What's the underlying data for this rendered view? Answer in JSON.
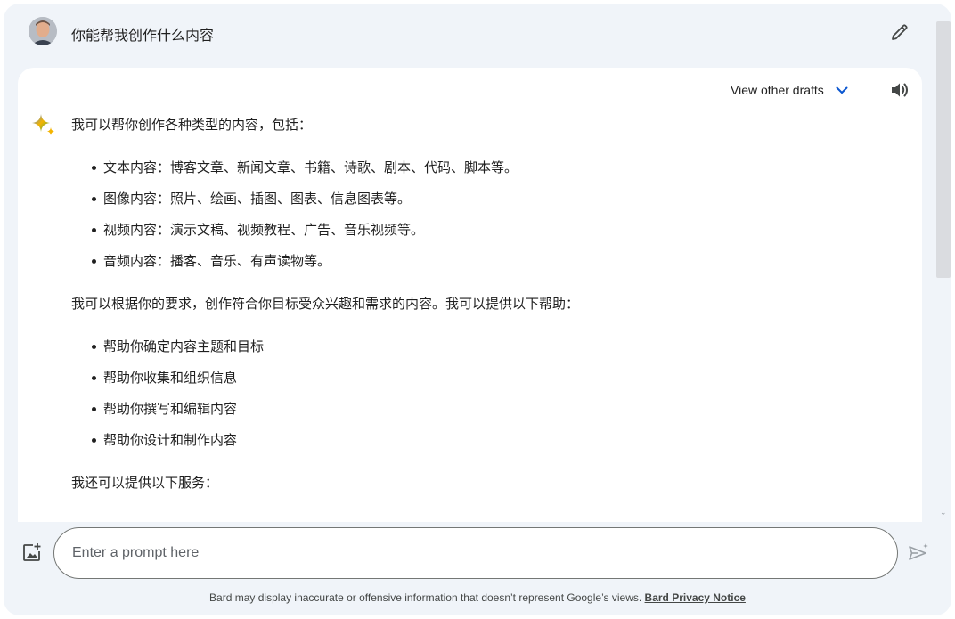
{
  "prompt": {
    "text": "你能帮我创作什么内容"
  },
  "response": {
    "drafts_label": "View other drafts",
    "intro": "我可以帮你创作各种类型的内容，包括：",
    "content_types": [
      "文本内容：博客文章、新闻文章、书籍、诗歌、剧本、代码、脚本等。",
      "图像内容：照片、绘画、插图、图表、信息图表等。",
      "视频内容：演示文稿、视频教程、广告、音乐视频等。",
      "音频内容：播客、音乐、有声读物等。"
    ],
    "help_intro": "我可以根据你的要求，创作符合你目标受众兴趣和需求的内容。我可以提供以下帮助：",
    "help_items": [
      "帮助你确定内容主题和目标",
      "帮助你收集和组织信息",
      "帮助你撰写和编辑内容",
      "帮助你设计和制作内容"
    ],
    "services_intro": "我还可以提供以下服务："
  },
  "input": {
    "placeholder": "Enter a prompt here",
    "value": ""
  },
  "footer": {
    "disclaimer": "Bard may display inaccurate or offensive information that doesn’t represent Google’s views.",
    "privacy_link": "Bard Privacy Notice"
  },
  "icons": {
    "edit": "pencil-icon",
    "drafts": "chevron-down-icon",
    "speaker": "speaker-icon",
    "sparkle": "bard-sparkle-icon",
    "image_upload": "image-upload-icon",
    "send": "send-icon"
  },
  "colors": {
    "background": "#f0f4f9",
    "card": "#ffffff",
    "accent_blue": "#0b57d0",
    "sparkle_blue": "#4285f4",
    "sparkle_yellow": "#f4b400",
    "sparkle_green": "#34a853"
  }
}
